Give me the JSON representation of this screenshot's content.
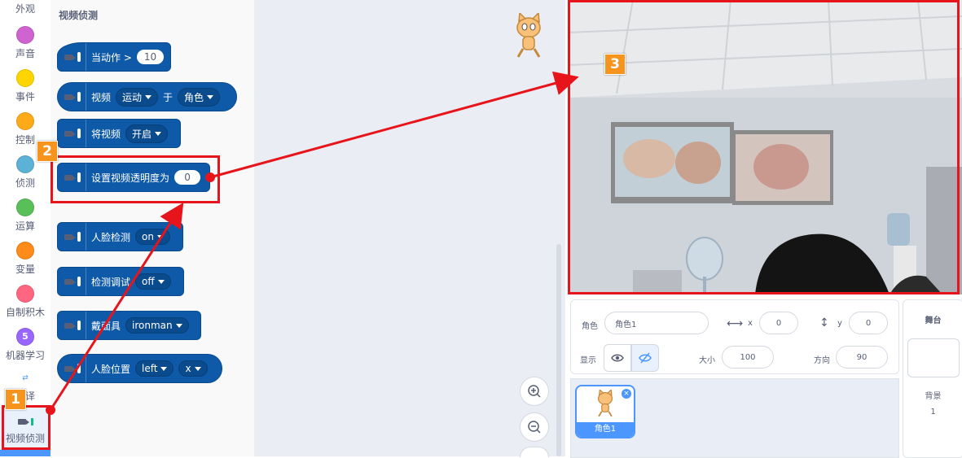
{
  "categories": [
    {
      "label": "外观",
      "color": ""
    },
    {
      "label": "声音",
      "color": "#cf63cf"
    },
    {
      "label": "事件",
      "color": "#ffd500"
    },
    {
      "label": "控制",
      "color": "#ffab19"
    },
    {
      "label": "侦测",
      "color": "#5cb1d6"
    },
    {
      "label": "运算",
      "color": "#59c059"
    },
    {
      "label": "变量",
      "color": "#ff8c1a"
    },
    {
      "label": "自制积木",
      "color": "#ff6680"
    },
    {
      "label": "机器学习",
      "color": "#9966ff",
      "number": "5"
    },
    {
      "label": "翻译",
      "color": ""
    },
    {
      "label": "视频侦测",
      "color": ""
    }
  ],
  "palette": {
    "title": "视频侦测",
    "blocks": {
      "when_motion": {
        "text": "当动作 >",
        "value": "10"
      },
      "video_on": {
        "text1": "视频",
        "menu1": "运动",
        "text2": "于",
        "menu2": "角色"
      },
      "turn_video": {
        "text": "将视频",
        "menu": "开启"
      },
      "transparency": {
        "text": "设置视频透明度为",
        "value": "0"
      },
      "face_detect": {
        "text": "人脸检测",
        "menu": "on"
      },
      "detect_debug": {
        "text": "检测调试",
        "menu": "off"
      },
      "mask": {
        "text": "戴面具",
        "menu": "ironman"
      },
      "face_pos": {
        "text": "人脸位置",
        "menu1": "left",
        "menu2": "x"
      }
    }
  },
  "sprite_info": {
    "sprite_label": "角色",
    "sprite_name": "角色1",
    "x_label": "x",
    "x_value": "0",
    "y_label": "y",
    "y_value": "0",
    "show_label": "显示",
    "size_label": "大小",
    "size_value": "100",
    "direction_label": "方向",
    "direction_value": "90"
  },
  "sprite_list": {
    "tile_label": "角色1"
  },
  "stage_panel": {
    "title": "舞台",
    "backdrop_label": "背景",
    "backdrop_count": "1"
  },
  "annotations": {
    "badge1": "1",
    "badge2": "2",
    "badge3": "3",
    "color": "#e8141b",
    "badge_color": "#f7941d"
  }
}
